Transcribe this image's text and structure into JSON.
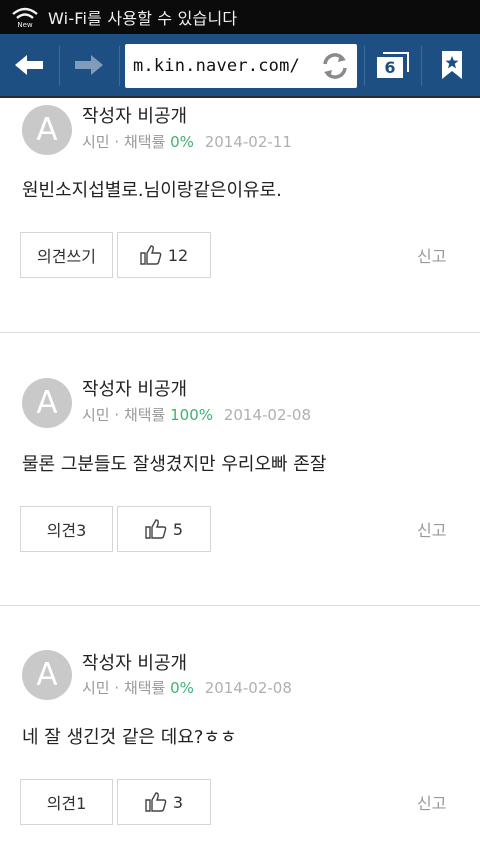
{
  "status_bar": {
    "text": "Wi-Fi를 사용할 수 있습니다",
    "wifi_icon": "wifi-new-icon"
  },
  "browser": {
    "back_icon": "arrow-left-icon",
    "forward_icon": "arrow-right-icon",
    "url": "m.kin.naver.com/",
    "reload_icon": "reload-icon",
    "tab_count": "6",
    "bookmark_icon": "bookmark-star-icon"
  },
  "answers": [
    {
      "avatar": "A",
      "author": "작성자 비공개",
      "rank": "시민",
      "sep": "·",
      "rate_label": "채택률",
      "rate": "0%",
      "date": "2014-02-11",
      "content": "원빈소지섭별로.님이랑같은이유로.",
      "opinion_label": "의견쓰기",
      "likes": "12",
      "report": "신고"
    },
    {
      "avatar": "A",
      "author": "작성자 비공개",
      "rank": "시민",
      "sep": "·",
      "rate_label": "채택률",
      "rate": "100%",
      "date": "2014-02-08",
      "content": "물론 그분들도 잘생겼지만 우리오빠 존잘",
      "opinion_label": "의견3",
      "likes": "5",
      "report": "신고"
    },
    {
      "avatar": "A",
      "author": "작성자 비공개",
      "rank": "시민",
      "sep": "·",
      "rate_label": "채택률",
      "rate": "0%",
      "date": "2014-02-08",
      "content": "네 잘 생긴것 같은 데요?ㅎㅎ",
      "opinion_label": "의견1",
      "likes": "3",
      "report": "신고"
    }
  ]
}
